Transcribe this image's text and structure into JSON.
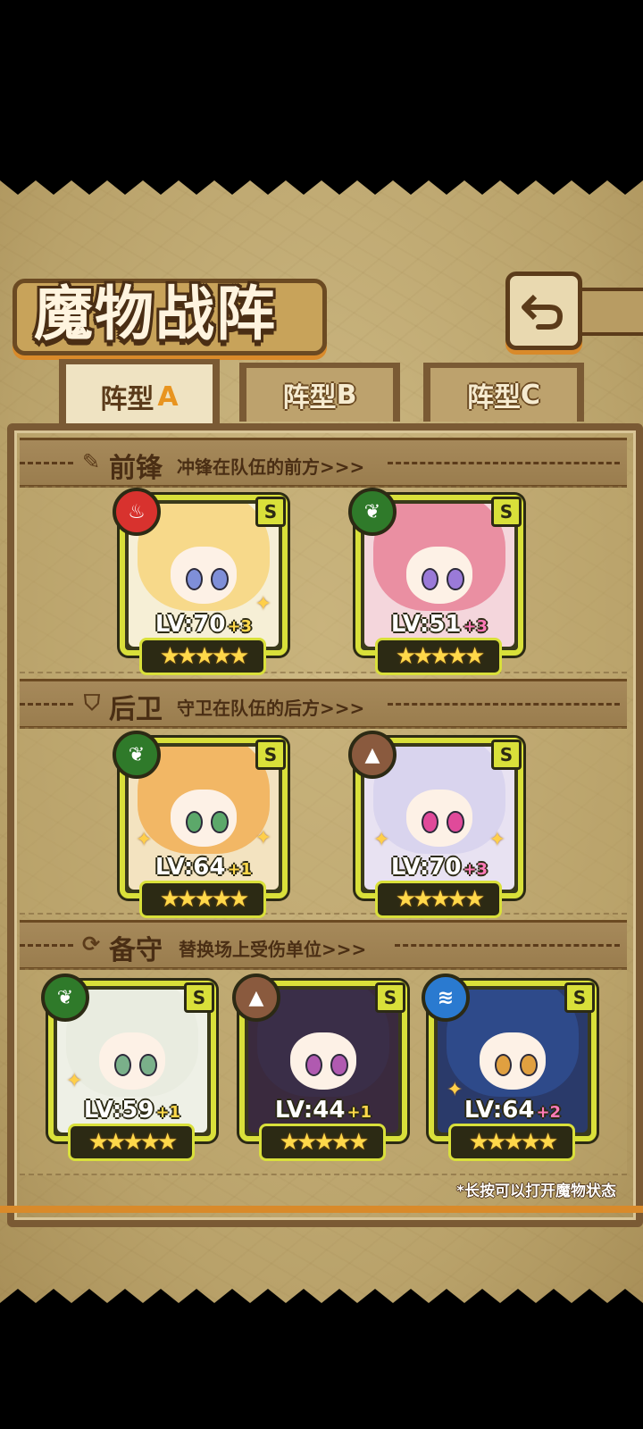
{
  "title": "魔物战阵",
  "tabs": [
    {
      "label": "阵型",
      "letter": "A",
      "active": true
    },
    {
      "label": "阵型",
      "letter": "B",
      "active": false
    },
    {
      "label": "阵型",
      "letter": "C",
      "active": false
    }
  ],
  "sections": {
    "front": {
      "title": "前锋",
      "desc": "冲锋在队伍的前方>>>"
    },
    "back": {
      "title": "后卫",
      "desc": "守卫在队伍的后方>>>"
    },
    "reserve": {
      "title": "备守",
      "desc": "替换场上受伤单位>>>"
    }
  },
  "cards": [
    {
      "rank": "S",
      "element": "fire",
      "lv": "LV:70",
      "plus": "+3",
      "stars": "★★★★★"
    },
    {
      "rank": "S",
      "element": "leaf",
      "lv": "LV:51",
      "plus": "+3",
      "stars": "★★★★★"
    },
    {
      "rank": "S",
      "element": "leaf",
      "lv": "LV:64",
      "plus": "+1",
      "stars": "★★★★★"
    },
    {
      "rank": "S",
      "element": "earth",
      "lv": "LV:70",
      "plus": "+3",
      "stars": "★★★★★"
    },
    {
      "rank": "S",
      "element": "leaf",
      "lv": "LV:59",
      "plus": "+1",
      "stars": "★★★★★"
    },
    {
      "rank": "S",
      "element": "earth",
      "lv": "LV:44",
      "plus": "+1",
      "stars": "★★★★★"
    },
    {
      "rank": "S",
      "element": "water",
      "lv": "LV:64",
      "plus": "+2",
      "stars": "★★★★★"
    }
  ],
  "hint": "*长按可以打开魔物状态",
  "colors": {
    "fire": "#d8322e",
    "leaf": "#2f7a2a",
    "earth": "#8a5a3e",
    "water": "#2a7ad0",
    "card_border": "#d9e03a"
  }
}
